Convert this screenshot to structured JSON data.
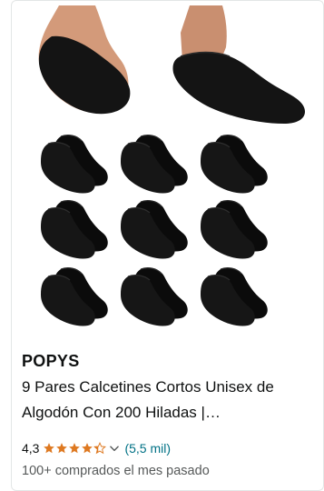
{
  "product": {
    "brand": "POPYS",
    "title_line1": "9 Pares Calcetines Cortos Unisex de",
    "title_line2": "Algodón Con 200 Hiladas |…",
    "rating_value": "4,3",
    "rating": 4.3,
    "reviews_label": "(5,5 mil)",
    "bought_text": "100+ comprados el mes pasado",
    "image_alt": "Calcetines cortos negros"
  },
  "colors": {
    "star": "#de7921",
    "link": "#007185",
    "muted": "#565959",
    "sock": "#111111"
  }
}
